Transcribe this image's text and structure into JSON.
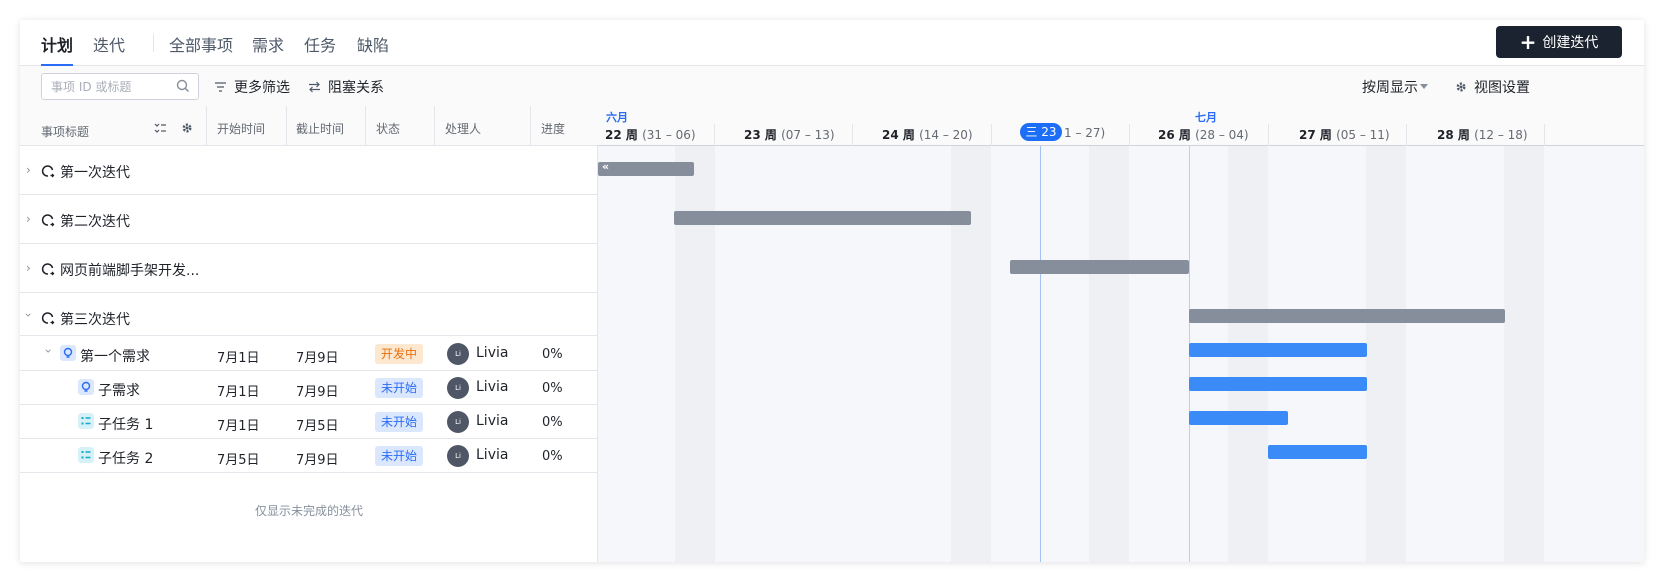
{
  "nav": {
    "tabs": [
      "计划",
      "迭代",
      "全部事项",
      "需求",
      "任务",
      "缺陷"
    ],
    "active_tab": "计划",
    "create_button": "创建迭代"
  },
  "toolbar": {
    "search_placeholder": "事项 ID 或标题",
    "more_filters": "更多筛选",
    "blocking_relations": "阻塞关系",
    "view_mode": "按周显示",
    "view_settings": "视图设置"
  },
  "table": {
    "columns": {
      "title": "事项标题",
      "start": "开始时间",
      "due": "截止时间",
      "status": "状态",
      "assignee": "处理人",
      "progress": "进度"
    },
    "groups": [
      {
        "name": "第一次迭代"
      },
      {
        "name": "第二次迭代"
      },
      {
        "name": "网页前端脚手架开发..."
      },
      {
        "name": "第三次迭代"
      }
    ],
    "items": [
      {
        "title": "第一个需求",
        "start": "7月1日",
        "due": "7月9日",
        "status": "开发中",
        "assignee": "Livia",
        "avatar_text": "Li",
        "progress": "0%",
        "type": "requirement"
      },
      {
        "title": "子需求",
        "start": "7月1日",
        "due": "7月9日",
        "status": "未开始",
        "assignee": "Livia",
        "avatar_text": "Li",
        "progress": "0%",
        "type": "requirement"
      },
      {
        "title": "子任务 1",
        "start": "7月1日",
        "due": "7月5日",
        "status": "未开始",
        "assignee": "Livia",
        "avatar_text": "Li",
        "progress": "0%",
        "type": "task"
      },
      {
        "title": "子任务 2",
        "start": "7月5日",
        "due": "7月9日",
        "status": "未开始",
        "assignee": "Livia",
        "avatar_text": "Li",
        "progress": "0%",
        "type": "task"
      }
    ],
    "footer_note": "仅显示未完成的迭代"
  },
  "timeline": {
    "months": [
      "六月",
      "七月"
    ],
    "weeks": [
      {
        "label": "22 周",
        "range": "(31 – 06)"
      },
      {
        "label": "23 周",
        "range": "(07 – 13)"
      },
      {
        "label": "24 周",
        "range": "(14 – 20)"
      },
      {
        "label": "",
        "range": "1 – 27)"
      },
      {
        "label": "26 周",
        "range": "(28 – 04)"
      },
      {
        "label": "27 周",
        "range": "(05 – 11)"
      },
      {
        "label": "28 周",
        "range": "(12 – 18)"
      }
    ],
    "today_label": "三 23",
    "collapse_marker": "«"
  },
  "colors": {
    "accent": "#2b6cf6",
    "iteration_bar": "#868e9c",
    "item_bar": "#3a8bf7",
    "status_dev_bg": "#fde7cf",
    "status_dev_fg": "#e8700e",
    "status_todo_bg": "#dae7fd",
    "status_todo_fg": "#2b6cf6",
    "create_button_bg": "#1b2230"
  }
}
